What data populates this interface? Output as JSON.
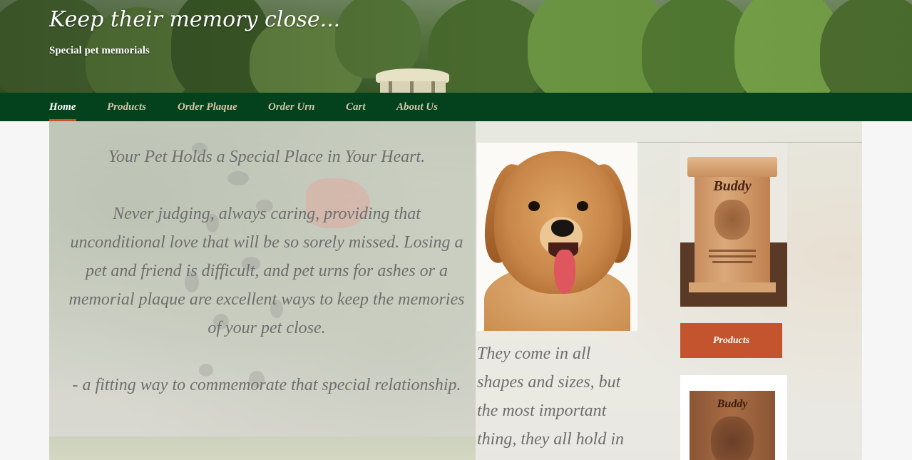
{
  "header": {
    "title": "Keep their memory close...",
    "tagline": "Special pet memorials"
  },
  "nav": {
    "items": [
      {
        "label": "Home",
        "active": true
      },
      {
        "label": "Products",
        "active": false
      },
      {
        "label": "Order Plaque",
        "active": false
      },
      {
        "label": "Order Urn",
        "active": false
      },
      {
        "label": "Cart",
        "active": false
      },
      {
        "label": "About Us",
        "active": false
      }
    ]
  },
  "main": {
    "heading": "Your Pet Holds a Special Place in Your Heart.",
    "body": "Never judging, always caring, providing that unconditional love that will be so sorely missed. Losing a pet and friend is difficult, and pet urns for ashes or a memorial plaque are excellent ways to keep the memories of your pet close.",
    "closing": "- a fitting way to commemorate that special relationship.",
    "sizes_text": "They come in all shapes and sizes, but the most important thing, they all hold in"
  },
  "sidebar": {
    "urn_name": "Buddy",
    "products_button": "Products",
    "plaque_name": "Buddy"
  },
  "colors": {
    "nav_bg": "#03421c",
    "nav_active": "#ffffff",
    "nav_inactive": "#d7c4a8",
    "accent": "#c3542e",
    "body_text": "#6e6e6e"
  }
}
